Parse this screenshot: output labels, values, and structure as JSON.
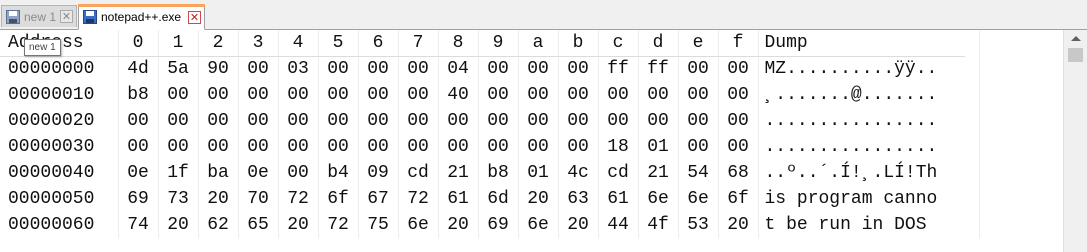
{
  "tabs": [
    {
      "label": "new 1",
      "state": "inactive"
    },
    {
      "label": "notepad++.exe",
      "state": "active"
    }
  ],
  "tooltip": "new 1",
  "hex_view": {
    "header": {
      "address": "Address",
      "columns": [
        "0",
        "1",
        "2",
        "3",
        "4",
        "5",
        "6",
        "7",
        "8",
        "9",
        "a",
        "b",
        "c",
        "d",
        "e",
        "f"
      ],
      "dump": "Dump"
    },
    "rows": [
      {
        "address": "00000000",
        "bytes": [
          "4d",
          "5a",
          "90",
          "00",
          "03",
          "00",
          "00",
          "00",
          "04",
          "00",
          "00",
          "00",
          "ff",
          "ff",
          "00",
          "00"
        ],
        "dump": "MZ..........ÿÿ.."
      },
      {
        "address": "00000010",
        "bytes": [
          "b8",
          "00",
          "00",
          "00",
          "00",
          "00",
          "00",
          "00",
          "40",
          "00",
          "00",
          "00",
          "00",
          "00",
          "00",
          "00"
        ],
        "dump": "¸.......@......."
      },
      {
        "address": "00000020",
        "bytes": [
          "00",
          "00",
          "00",
          "00",
          "00",
          "00",
          "00",
          "00",
          "00",
          "00",
          "00",
          "00",
          "00",
          "00",
          "00",
          "00"
        ],
        "dump": "................"
      },
      {
        "address": "00000030",
        "bytes": [
          "00",
          "00",
          "00",
          "00",
          "00",
          "00",
          "00",
          "00",
          "00",
          "00",
          "00",
          "00",
          "18",
          "01",
          "00",
          "00"
        ],
        "dump": "................"
      },
      {
        "address": "00000040",
        "bytes": [
          "0e",
          "1f",
          "ba",
          "0e",
          "00",
          "b4",
          "09",
          "cd",
          "21",
          "b8",
          "01",
          "4c",
          "cd",
          "21",
          "54",
          "68"
        ],
        "dump": "..º..´.Í!¸.LÍ!Th"
      },
      {
        "address": "00000050",
        "bytes": [
          "69",
          "73",
          "20",
          "70",
          "72",
          "6f",
          "67",
          "72",
          "61",
          "6d",
          "20",
          "63",
          "61",
          "6e",
          "6e",
          "6f"
        ],
        "dump": "is program canno"
      },
      {
        "address": "00000060",
        "bytes": [
          "74",
          "20",
          "62",
          "65",
          "20",
          "72",
          "75",
          "6e",
          "20",
          "69",
          "6e",
          "20",
          "44",
          "4f",
          "53",
          "20"
        ],
        "dump": "t be run in DOS "
      }
    ]
  },
  "colors": {
    "active_tab_accent": "#fba45e",
    "close_red": "#c02020",
    "save_icon_blue": "#3a6fc4"
  }
}
